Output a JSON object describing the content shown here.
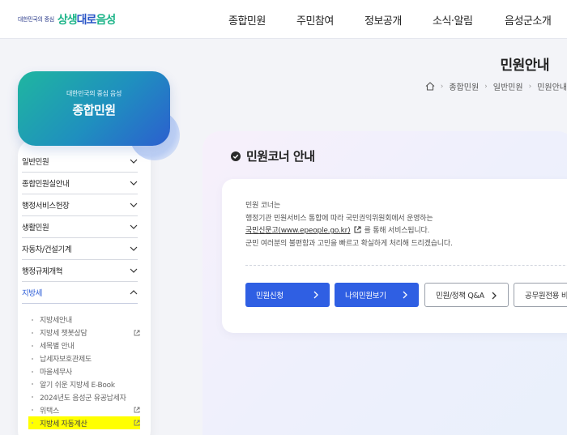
{
  "header": {
    "logo_small": "대한민국의 중심",
    "logo_brand_a": "상생",
    "logo_brand_b": "대로",
    "logo_brand_c": "음성",
    "nav": [
      "종합민원",
      "주민참여",
      "정보공개",
      "소식·알림",
      "음성군소개"
    ]
  },
  "title": {
    "page_title": "민원안내",
    "breadcrumb": [
      "종합민원",
      "일반민원",
      "민원안내"
    ]
  },
  "badge": {
    "subtitle": "대한민국의 중심 음성",
    "title": "종합민원"
  },
  "sidebar": {
    "items": [
      {
        "label": "일반민원",
        "expanded": false
      },
      {
        "label": "종합민원실안내",
        "expanded": false
      },
      {
        "label": "행정서비스헌장",
        "expanded": false
      },
      {
        "label": "생활민원",
        "expanded": false
      },
      {
        "label": "자동차/건설기계",
        "expanded": false
      },
      {
        "label": "행정규제개혁",
        "expanded": false
      },
      {
        "label": "지방세",
        "expanded": true
      }
    ],
    "sub_items": [
      {
        "label": "지방세안내",
        "external": false
      },
      {
        "label": "지방세 챗봇상담",
        "external": true
      },
      {
        "label": "세목별 안내",
        "external": false
      },
      {
        "label": "납세자보호관제도",
        "external": false
      },
      {
        "label": "마을세무사",
        "external": false
      },
      {
        "label": "알기 쉬운 지방세 E-Book",
        "external": false
      },
      {
        "label": "2024년도 음성군 유공납세자",
        "external": false
      },
      {
        "label": "위택스",
        "external": true
      },
      {
        "label": "지방세 자동계산",
        "external": true,
        "highlighted": true
      }
    ]
  },
  "main": {
    "heading": "민원코너 안내",
    "lines": [
      "민원 코너는",
      "행정기관 민원서비스 통합에 따라 국민권익위원회에서 운영하는",
      "를 통해 서비스됩니다.",
      "군민 여러분의 불편함과 고민을 빠르고 확실하게 처리해 드리겠습니다."
    ],
    "link_text": "국민신문고(www.epeople.go.kr)",
    "buttons": [
      {
        "label": "민원신청",
        "style": "primary"
      },
      {
        "label": "나의민원보기",
        "style": "primary"
      },
      {
        "label": "민원/정책 Q&A",
        "style": "outline"
      },
      {
        "label": "공무원전용 비",
        "style": "outline"
      }
    ]
  },
  "colors": {
    "primary": "#2f5fe3",
    "highlight": "#ffff00",
    "badge_from": "#1fb6a0",
    "badge_to": "#2c5fcf"
  }
}
